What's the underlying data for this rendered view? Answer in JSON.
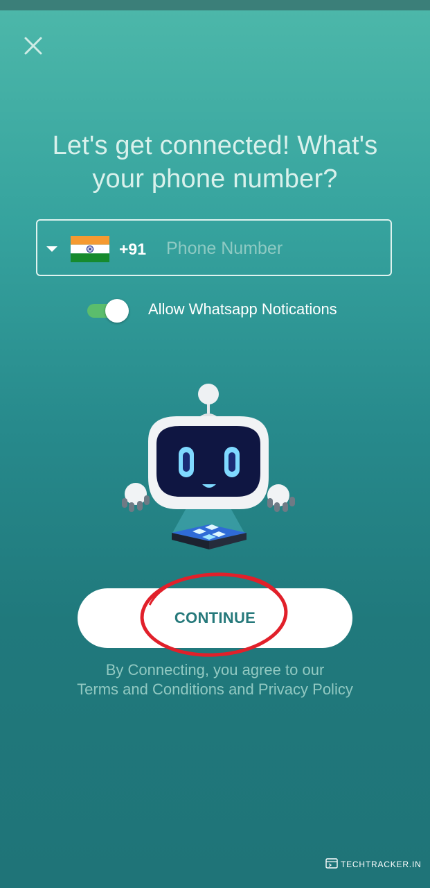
{
  "header": {
    "close_icon": "close-icon"
  },
  "headline": {
    "line1": "Let's get connected! What's",
    "line2": "your phone number?"
  },
  "phone_field": {
    "dropdown_icon": "caret-down-icon",
    "country_flag": "india-flag",
    "dial_code": "+91",
    "placeholder": "Phone Number",
    "value": ""
  },
  "whatsapp_toggle": {
    "state": "on",
    "label": "Allow Whatsapp Notications"
  },
  "illustration": {
    "icon": "robot-illustration"
  },
  "continue_button": {
    "label": "CONTINUE",
    "annotation": "red-circle-highlight"
  },
  "legal": {
    "line1": "By Connecting, you agree to our",
    "terms_link": "Terms and Conditions",
    "conjunction": "and",
    "privacy_link": "Privacy Policy"
  },
  "watermark": {
    "text": "TECHTRACKER.IN"
  },
  "colors": {
    "accent": "#26797b",
    "toggle_on": "#5bbd6c",
    "highlight": "#e1202a"
  }
}
